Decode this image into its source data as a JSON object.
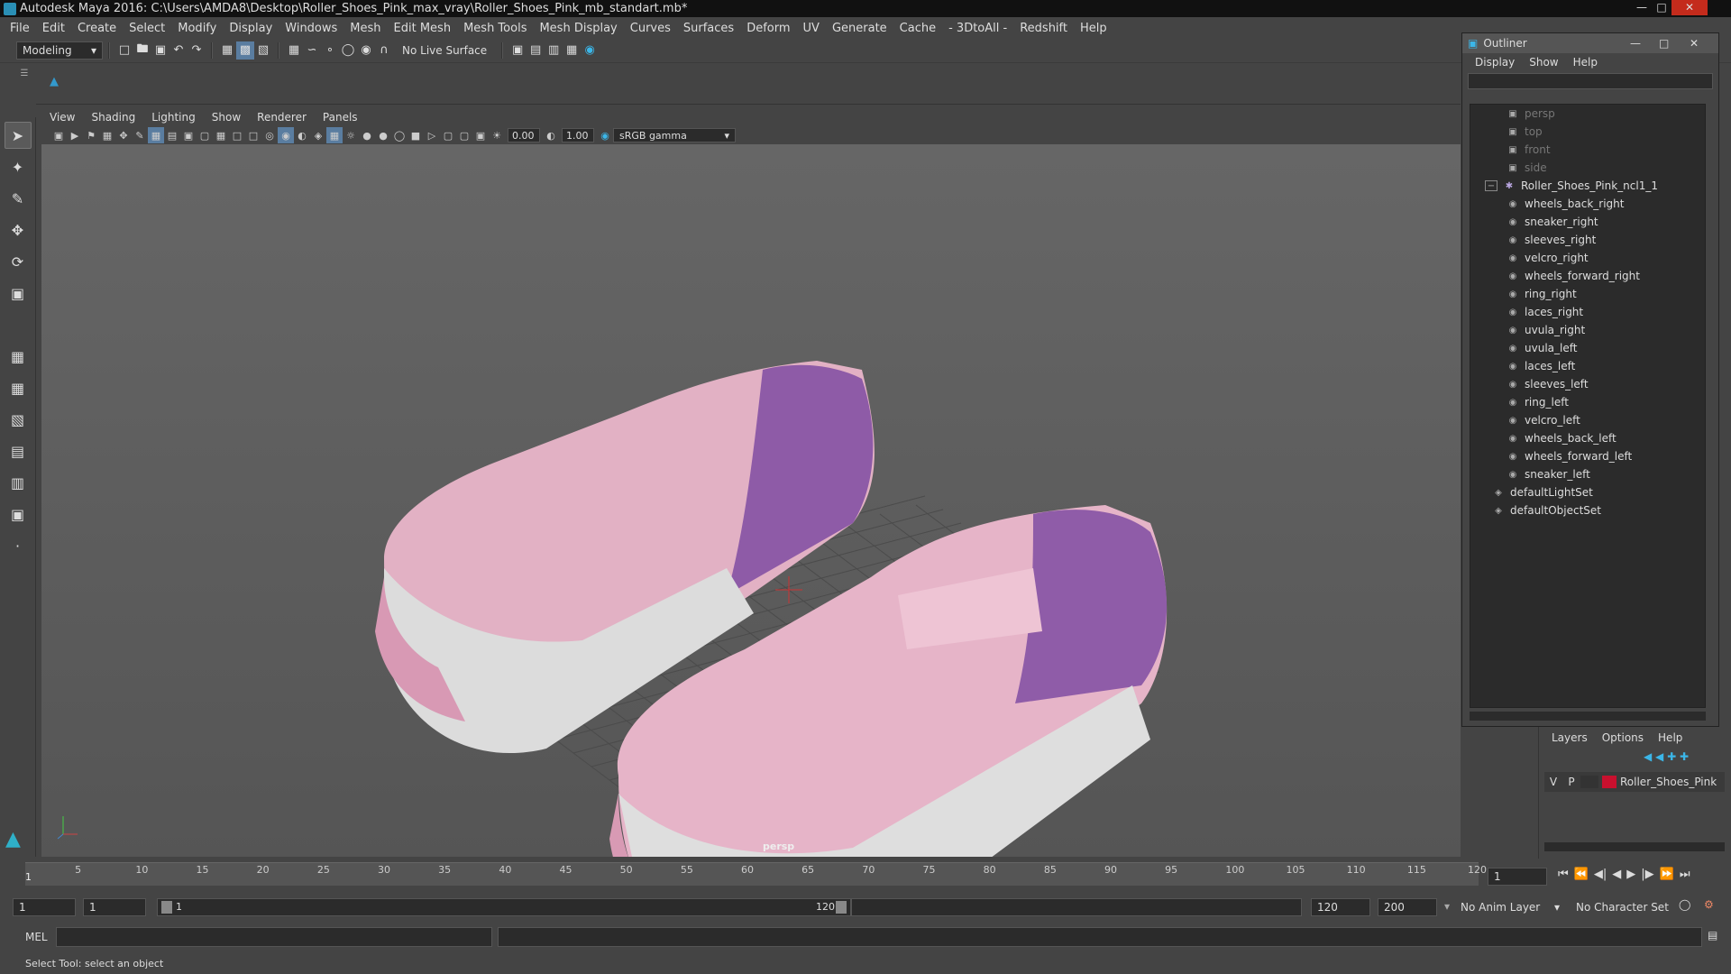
{
  "window": {
    "title": "Autodesk Maya 2016: C:\\Users\\AMDA8\\Desktop\\Roller_Shoes_Pink_max_vray\\Roller_Shoes_Pink_mb_standart.mb*"
  },
  "menubar": [
    "File",
    "Edit",
    "Create",
    "Select",
    "Modify",
    "Display",
    "Windows",
    "Mesh",
    "Edit Mesh",
    "Mesh Tools",
    "Mesh Display",
    "Curves",
    "Surfaces",
    "Deform",
    "UV",
    "Generate",
    "Cache",
    "- 3DtoAll -",
    "Redshift",
    "Help"
  ],
  "statusline": {
    "mode": "Modeling",
    "live_surface": "No Live Surface"
  },
  "panel_menu": [
    "View",
    "Shading",
    "Lighting",
    "Show",
    "Renderer",
    "Panels"
  ],
  "panel_tools": {
    "exposure": "0.00",
    "gamma": "1.00",
    "color_space": "sRGB gamma"
  },
  "viewport": {
    "camera_label": "persp"
  },
  "outliner": {
    "title": "Outliner",
    "menu": [
      "Display",
      "Show",
      "Help"
    ],
    "cameras": [
      "persp",
      "top",
      "front",
      "side"
    ],
    "group": "Roller_Shoes_Pink_ncl1_1",
    "children": [
      "wheels_back_right",
      "sneaker_right",
      "sleeves_right",
      "velcro_right",
      "wheels_forward_right",
      "ring_right",
      "laces_right",
      "uvula_right",
      "uvula_left",
      "laces_left",
      "sleeves_left",
      "ring_left",
      "velcro_left",
      "wheels_back_left",
      "wheels_forward_left",
      "sneaker_left"
    ],
    "sets": [
      "defaultLightSet",
      "defaultObjectSet"
    ]
  },
  "layers": {
    "menu": [
      "Layers",
      "Options",
      "Help"
    ],
    "layer": {
      "v": "V",
      "p": "P",
      "name": "Roller_Shoes_Pink",
      "color": "#c8102e"
    }
  },
  "timeline": {
    "ticks": [
      "5",
      "10",
      "15",
      "20",
      "25",
      "30",
      "35",
      "40",
      "45",
      "50",
      "55",
      "60",
      "65",
      "70",
      "75",
      "80",
      "85",
      "90",
      "95",
      "100",
      "105",
      "110",
      "115",
      "120"
    ],
    "current_frame": "1",
    "frame_field": "1"
  },
  "range": {
    "start": "1",
    "start2": "1",
    "slider_start": "1",
    "slider_end": "120",
    "end": "120",
    "end2": "200",
    "anim_layer": "No Anim Layer",
    "char_set": "No Character Set"
  },
  "cmdline": {
    "label": "MEL"
  },
  "helpline": {
    "text": "Select Tool: select an object"
  }
}
